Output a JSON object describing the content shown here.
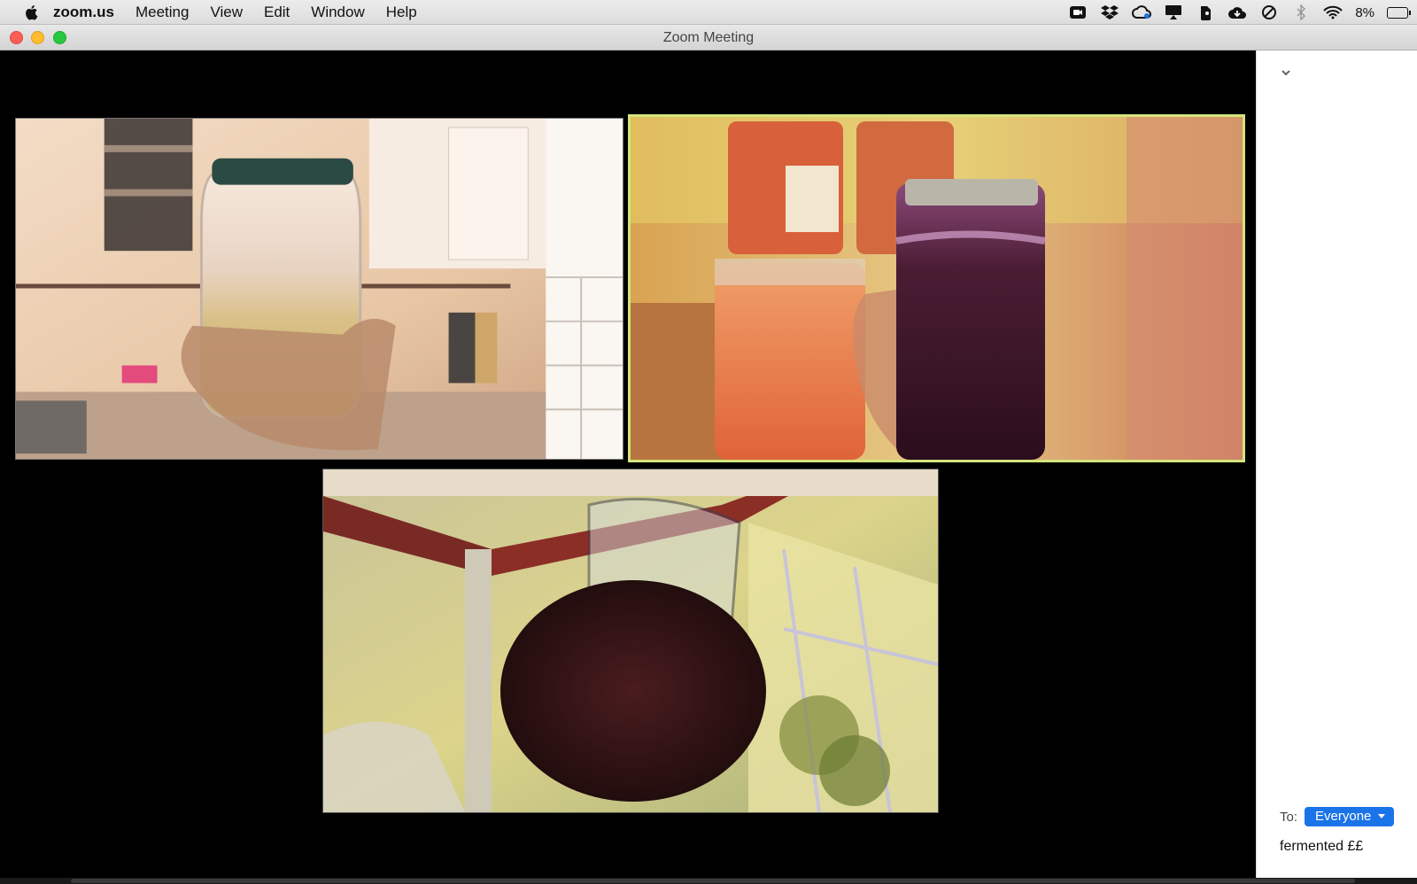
{
  "menubar": {
    "app_name": "zoom.us",
    "items": [
      "Meeting",
      "View",
      "Edit",
      "Window",
      "Help"
    ],
    "battery_percent": "8%",
    "status_icons": [
      "zoom-icon",
      "dropbox-icon",
      "creative-cloud-icon",
      "airplay-icon",
      "evernote-icon",
      "cloud-download-icon",
      "do-not-disturb-icon",
      "bluetooth-icon",
      "wifi-icon",
      "battery-icon"
    ]
  },
  "window": {
    "title": "Zoom Meeting"
  },
  "videos": [
    {
      "id": "participant-1",
      "active_speaker": false
    },
    {
      "id": "participant-2",
      "active_speaker": true
    },
    {
      "id": "participant-3",
      "active_speaker": false
    }
  ],
  "chat": {
    "to_label": "To:",
    "recipient": "Everyone",
    "draft_message": "fermented ££"
  },
  "colors": {
    "active_speaker_border": "#d4e57b",
    "recipient_button": "#1a73e8"
  }
}
